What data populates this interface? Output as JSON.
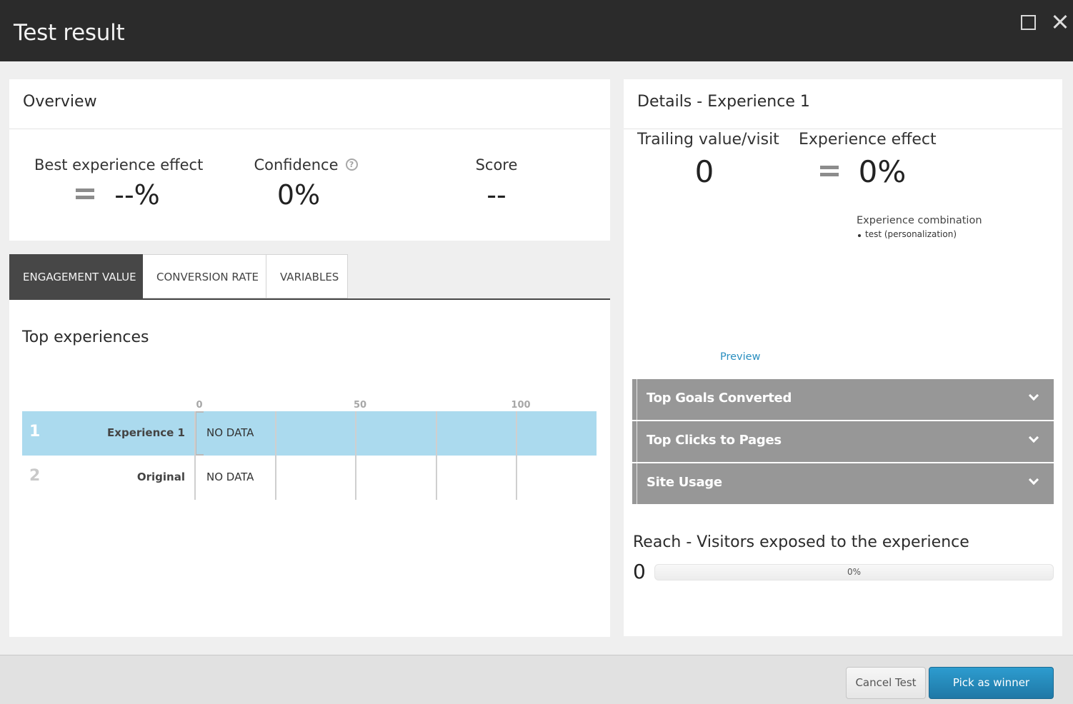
{
  "window": {
    "title": "Test result",
    "maximize_icon": "maximize-icon",
    "close_icon": "close-icon"
  },
  "overview": {
    "title": "Overview",
    "metrics": [
      {
        "label": "Best experience effect",
        "value": "--%",
        "icon": "equals-icon"
      },
      {
        "label": "Confidence",
        "value": "0%",
        "icon": "help-icon",
        "icon_glyph": "?"
      },
      {
        "label": "Score",
        "value": "--"
      }
    ]
  },
  "tabs": [
    {
      "label": "ENGAGEMENT VALUE",
      "active": true
    },
    {
      "label": "CONVERSION RATE",
      "active": false
    },
    {
      "label": "VARIABLES",
      "active": false
    }
  ],
  "top_experiences": {
    "title": "Top experiences",
    "chart_data": {
      "type": "bar",
      "title": "Top experiences",
      "xlabel": "",
      "ylabel": "",
      "xlim": [
        0,
        125
      ],
      "ticks": [
        0,
        25,
        50,
        75,
        100
      ],
      "tick_labels": [
        "0",
        "",
        "50",
        "",
        "100"
      ],
      "grid": true,
      "categories": [
        "Experience 1",
        "Original"
      ],
      "ranks": [
        "1",
        "2"
      ],
      "values": [
        null,
        null
      ],
      "value_labels": [
        "NO DATA",
        "NO DATA"
      ],
      "highlighted": "Experience 1"
    }
  },
  "details": {
    "title": "Details - Experience 1",
    "trailing_label": "Trailing value/visit",
    "trailing_value": "0",
    "effect_label": "Experience effect",
    "effect_value": "0%",
    "effect_icon": "equals-icon",
    "combination_label": "Experience combination",
    "combination_items": [
      "test (personalization)"
    ],
    "preview_label": "Preview",
    "accordions": [
      {
        "label": "Top Goals Converted",
        "icon": "chevron-down-icon"
      },
      {
        "label": "Top Clicks to Pages",
        "icon": "chevron-down-icon"
      },
      {
        "label": "Site Usage",
        "icon": "chevron-down-icon"
      }
    ],
    "reach": {
      "title": "Reach - Visitors exposed to the experience",
      "count": "0",
      "percent_label": "0%",
      "fraction": 0
    }
  },
  "footer": {
    "cancel_label": "Cancel Test",
    "winner_label": "Pick as winner"
  },
  "colors": {
    "titlebar": "#2b2b2b",
    "accent": "#2a8fc0",
    "highlight_row": "#abdaee",
    "accordion": "#979797",
    "active_tab": "#474747"
  }
}
